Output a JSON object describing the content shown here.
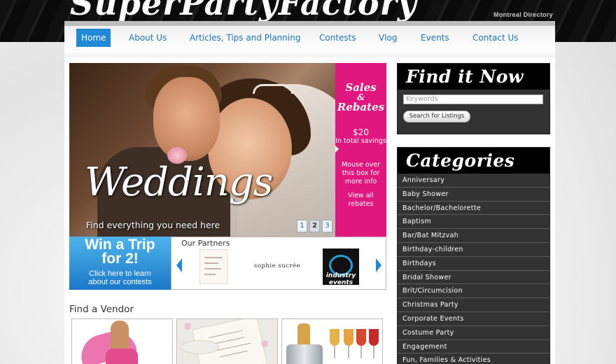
{
  "header": {
    "logo_text": "SuperPartyFactory",
    "directory_link": "Montreal Directory"
  },
  "nav": {
    "items": [
      {
        "label": "Home",
        "active": true
      },
      {
        "label": "About Us"
      },
      {
        "label": "Articles, Tips and Planning"
      },
      {
        "label": "Contests"
      },
      {
        "label": "Vlog"
      },
      {
        "label": "Events"
      },
      {
        "label": "Contact Us"
      }
    ]
  },
  "slider": {
    "title": "Weddings",
    "subtitle": "Find everything you need here",
    "pages": [
      "1",
      "2",
      "3"
    ],
    "active_page": 2
  },
  "sales": {
    "title_1": "Sales",
    "amp": "&",
    "title_2": "Rebates",
    "amount": "$20",
    "total_text": "In total savings",
    "hover_text": "Mouse over this box for more info",
    "view_link": "View all rebates"
  },
  "trip": {
    "title_line1": "Win a Trip",
    "title_line2": "for 2!",
    "sub_line1": "Click here to learn",
    "sub_line2": "about our contests"
  },
  "partners": {
    "title": "Our Partners",
    "items": [
      {
        "icon": "invitation-card-logo"
      },
      {
        "name": "sophie sucrée"
      },
      {
        "name": "industry",
        "sub": "events"
      }
    ]
  },
  "vendors": {
    "title": "Find a Vendor",
    "items": [
      {
        "icon": "belly-dancer-photo"
      },
      {
        "icon": "invitation-photo"
      },
      {
        "icon": "drinks-photo"
      }
    ]
  },
  "find_it_now": {
    "title": "Find it Now",
    "keyword_placeholder": "Keywords",
    "search_button": "Search for Listings"
  },
  "categories": {
    "title": "Categories",
    "items": [
      "Anniversary",
      "Baby Shower",
      "Bachelor/Bachelorette",
      "Baptism",
      "Bar/Bat Mitzvah",
      "Birthday-children",
      "Birthdays",
      "Bridal Shower",
      "Brit/Circumcision",
      "Christmas Party",
      "Corporate Events",
      "Costume Party",
      "Engagement",
      "Fun, Families & Activities"
    ]
  },
  "colors": {
    "nav_active": "#1e89d4",
    "nav_link": "#1d74b8",
    "sales_bg": "#e0177f",
    "trip_bg": "#1a78c8",
    "sidebar_bg": "#333333"
  }
}
